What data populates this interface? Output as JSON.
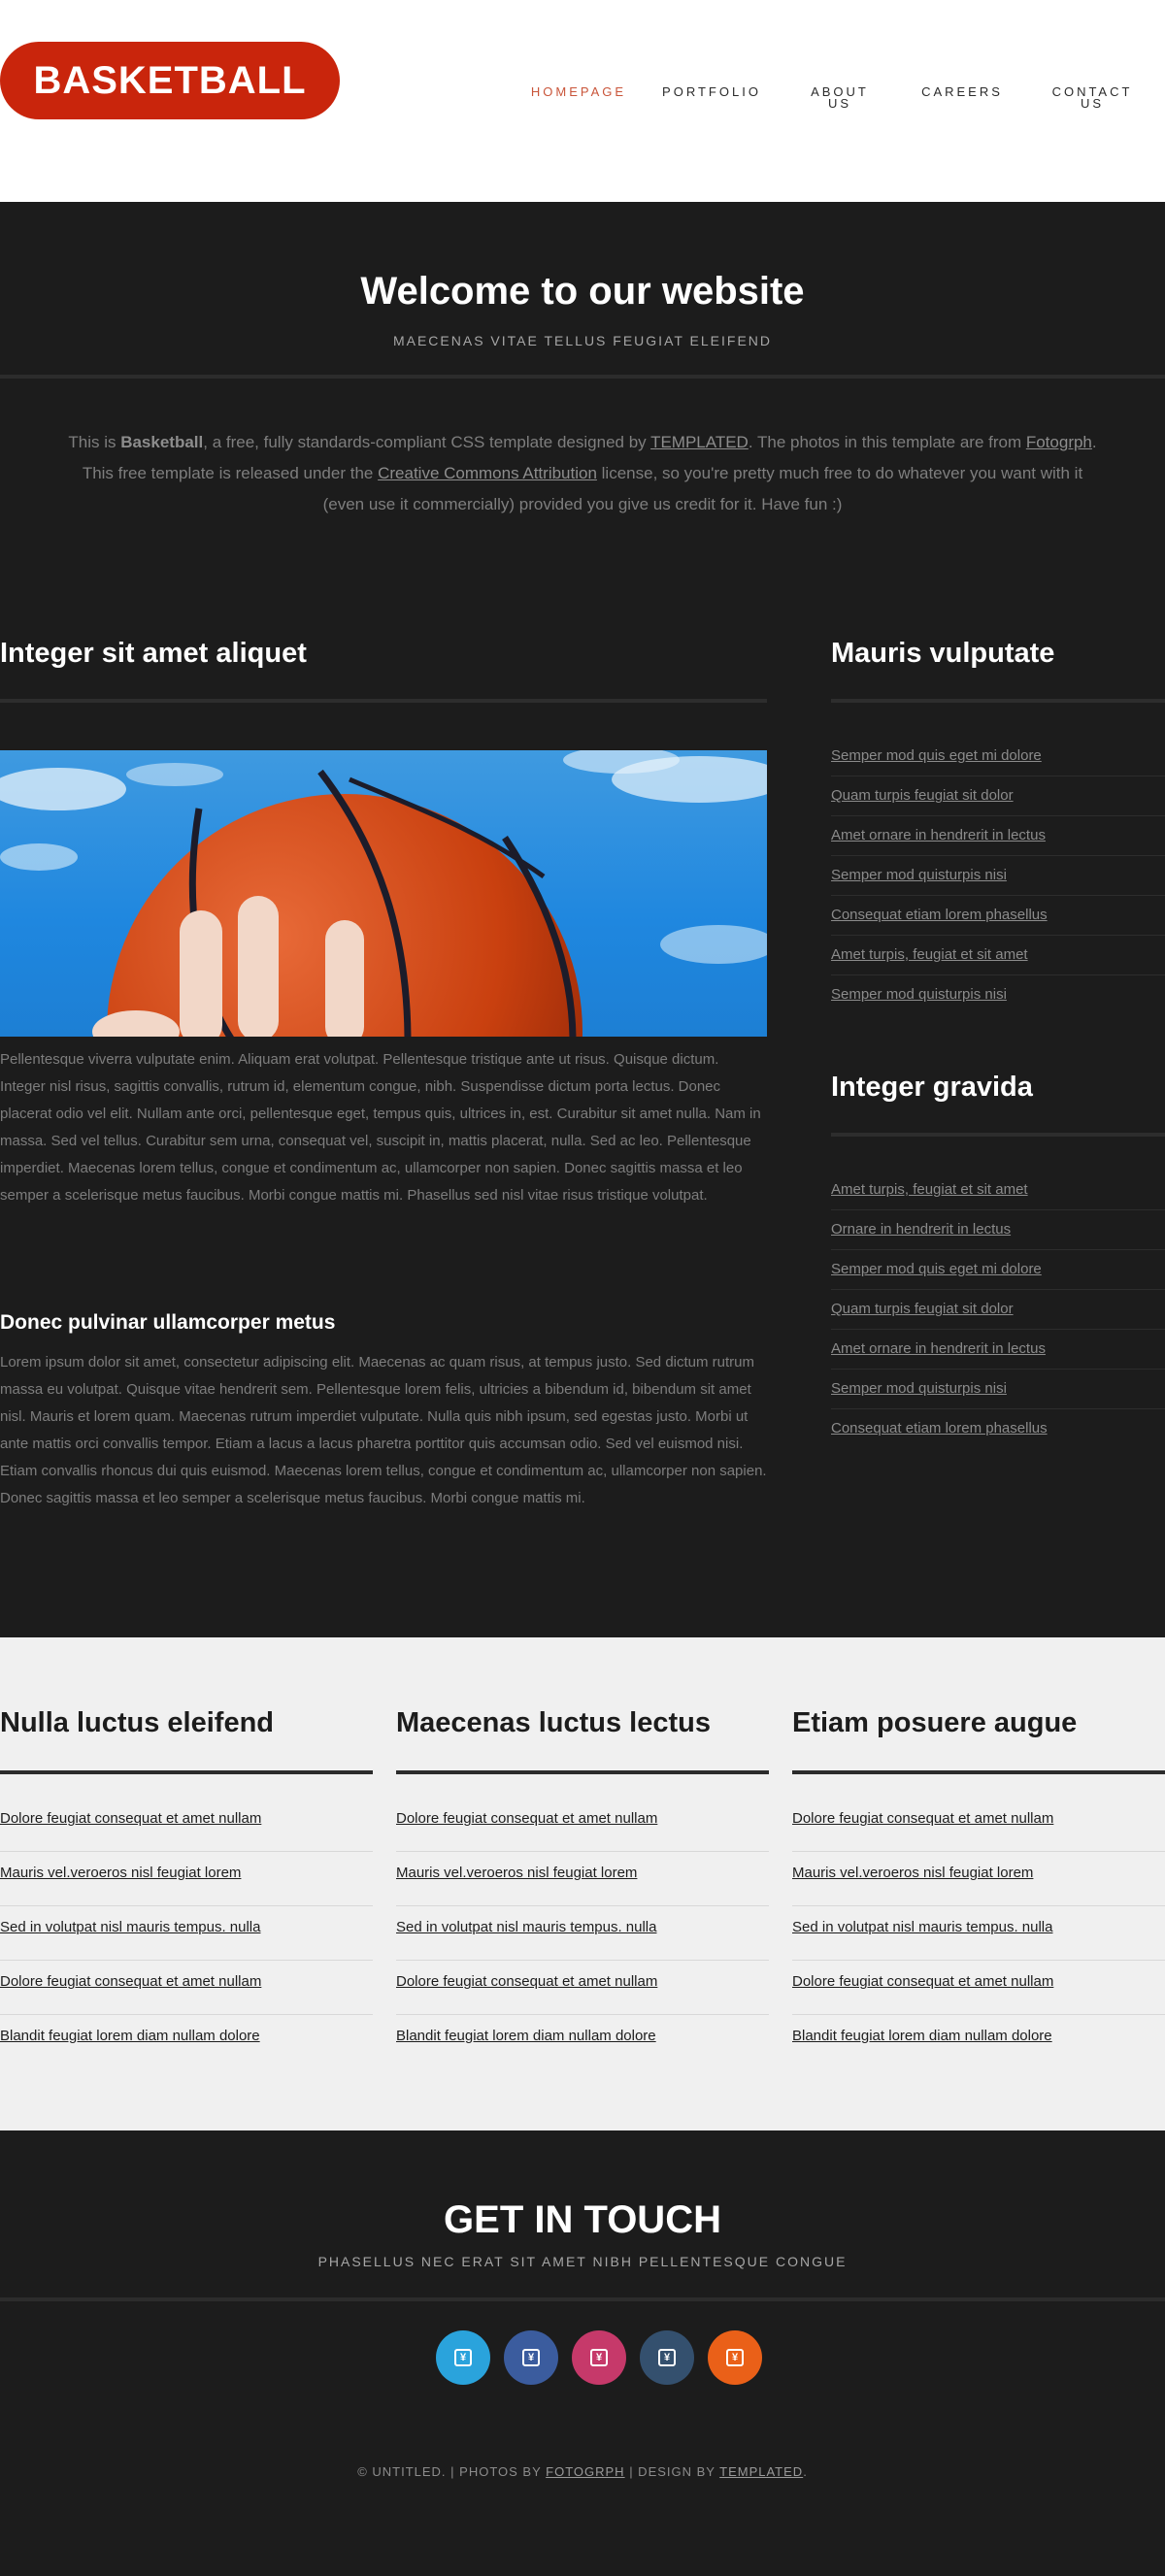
{
  "header": {
    "logo": "BASKETBALL",
    "nav": [
      {
        "label": "HOMEPAGE",
        "active": true
      },
      {
        "label": "PORTFOLIO",
        "active": false
      },
      {
        "label": "ABOUT US",
        "active": false
      },
      {
        "label": "CAREERS",
        "active": false
      },
      {
        "label": "CONTACT US",
        "active": false
      }
    ]
  },
  "intro": {
    "title": "Welcome to our website",
    "subtitle": "MAECENAS VITAE TELLUS FEUGIAT ELEIFEND",
    "desc_1": "This is ",
    "desc_bold": "Basketball",
    "desc_2": ", a free, fully standards-compliant CSS template designed by ",
    "desc_link_1": "TEMPLATED",
    "desc_3": ". The photos in this template are from ",
    "desc_link_2": "Fotogrph",
    "desc_4": ". This free template is released under the ",
    "desc_link_3": "Creative Commons Attribution",
    "desc_5": " license, so you're pretty much free to do whatever you want with it (even use it commercially) provided you give us credit for it. Have fun :)"
  },
  "main": {
    "left_title": "Integer sit amet aliquet",
    "paragraph_1": "Pellentesque viverra vulputate enim. Aliquam erat volutpat. Pellentesque tristique ante ut risus. Quisque dictum. Integer nisl risus, sagittis convallis, rutrum id, elementum congue, nibh. Suspendisse dictum porta lectus. Donec placerat odio vel elit. Nullam ante orci, pellentesque eget, tempus quis, ultrices in, est. Curabitur sit amet nulla. Nam in massa. Sed vel tellus. Curabitur sem urna, consequat vel, suscipit in, mattis placerat, nulla. Sed ac leo. Pellentesque imperdiet. Maecenas lorem tellus, congue et condimentum ac, ullamcorper non sapien. Donec sagittis massa et leo semper a scelerisque metus faucibus. Morbi congue mattis mi. Phasellus sed nisl vitae risus tristique volutpat.",
    "subheading": "Donec pulvinar ullamcorper metus",
    "paragraph_2": "Lorem ipsum dolor sit amet, consectetur adipiscing elit. Maecenas ac quam risus, at tempus justo. Sed dictum rutrum massa eu volutpat. Quisque vitae hendrerit sem. Pellentesque lorem felis, ultricies a bibendum id, bibendum sit amet nisl. Mauris et lorem quam. Maecenas rutrum imperdiet vulputate. Nulla quis nibh ipsum, sed egestas justo. Morbi ut ante mattis orci convallis tempor. Etiam a lacus a lacus pharetra porttitor quis accumsan odio. Sed vel euismod nisi. Etiam convallis rhoncus dui quis euismod. Maecenas lorem tellus, congue et condimentum ac, ullamcorper non sapien. Donec sagittis massa et leo semper a scelerisque metus faucibus. Morbi congue mattis mi.",
    "sidebar_1": {
      "title": "Mauris vulputate",
      "links": [
        "Semper mod quis eget mi dolore",
        "Quam turpis feugiat sit dolor",
        "Amet ornare in hendrerit in lectus",
        "Semper mod quisturpis nisi",
        "Consequat etiam lorem phasellus",
        "Amet turpis, feugiat et sit amet",
        "Semper mod quisturpis nisi"
      ]
    },
    "sidebar_2": {
      "title": "Integer gravida",
      "links": [
        "Amet turpis, feugiat et sit amet",
        "Ornare in hendrerit in lectus",
        "Semper mod quis eget mi dolore",
        "Quam turpis feugiat sit dolor",
        "Amet ornare in hendrerit in lectus",
        "Semper mod quisturpis nisi",
        "Consequat etiam lorem phasellus"
      ]
    }
  },
  "lists": [
    {
      "title": "Nulla luctus eleifend",
      "links": [
        "Dolore feugiat consequat et amet nullam",
        "Mauris vel.veroeros nisl feugiat lorem",
        "Sed in volutpat nisl mauris tempus. nulla",
        "Dolore feugiat consequat et amet nullam",
        "Blandit feugiat lorem diam nullam dolore"
      ]
    },
    {
      "title": "Maecenas luctus lectus",
      "links": [
        "Dolore feugiat consequat et amet nullam",
        "Mauris vel.veroeros nisl feugiat lorem",
        "Sed in volutpat nisl mauris tempus. nulla",
        "Dolore feugiat consequat et amet nullam",
        "Blandit feugiat lorem diam nullam dolore"
      ]
    },
    {
      "title": "Etiam posuere augue",
      "links": [
        "Dolore feugiat consequat et amet nullam",
        "Mauris vel.veroeros nisl feugiat lorem",
        "Sed in volutpat nisl mauris tempus. nulla",
        "Dolore feugiat consequat et amet nullam",
        "Blandit feugiat lorem diam nullam dolore"
      ]
    }
  ],
  "contact": {
    "title": "GET IN TOUCH",
    "subtitle": "PHASELLUS NEC ERAT SIT AMET NIBH PELLENTESQUE CONGUE",
    "socials": [
      {
        "icon": "twitter-icon",
        "color": "#2aa3dc"
      },
      {
        "icon": "facebook-icon",
        "color": "#3b5c9e"
      },
      {
        "icon": "dribbble-icon",
        "color": "#c6396a"
      },
      {
        "icon": "tumblr-icon",
        "color": "#34506e"
      },
      {
        "icon": "rss-icon",
        "color": "#ea6018"
      }
    ],
    "copyright_1": "© UNTITLED. | PHOTOS BY ",
    "copyright_link_1": "FOTOGRPH",
    "copyright_2": " | DESIGN BY ",
    "copyright_link_2": "TEMPLATED",
    "copyright_3": "."
  },
  "colors": {
    "accent": "#c9250c",
    "nav_active": "#c9553a",
    "dark_bg": "#1c1c1c",
    "light_bg": "#f0f0f0"
  }
}
